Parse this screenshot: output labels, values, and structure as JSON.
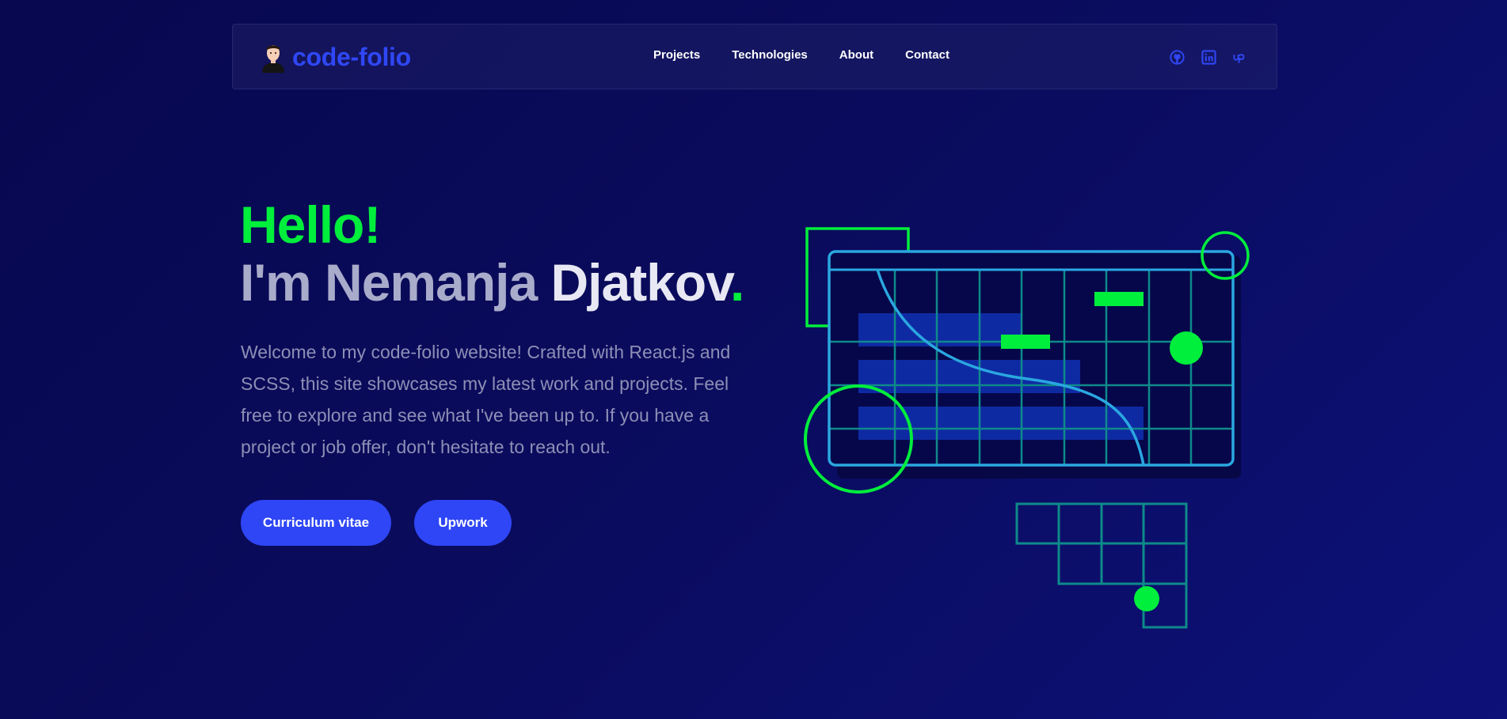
{
  "navbar": {
    "brand": "code-folio",
    "links": [
      "Projects",
      "Technologies",
      "About",
      "Contact"
    ],
    "social": [
      "github-icon",
      "linkedin-icon",
      "upwork-icon"
    ]
  },
  "hero": {
    "greeting": "Hello!",
    "name_first": "I'm Nemanja",
    "name_last": "Djatkov",
    "name_dot": ".",
    "description": "Welcome to my code-folio website! Crafted with React.js and SCSS, this site showcases my latest work and projects. Feel free to explore and see what I've been up to. If you have a project or job offer, don't hesitate to reach out.",
    "buttons": [
      "Curriculum vitae",
      "Upwork"
    ]
  },
  "colors": {
    "background": "#0a0b5c",
    "accent_green": "#00ee3c",
    "accent_blue": "#2e46f5",
    "illustration_line": "#2aa7e0",
    "grid_teal": "#0e8a8a"
  }
}
